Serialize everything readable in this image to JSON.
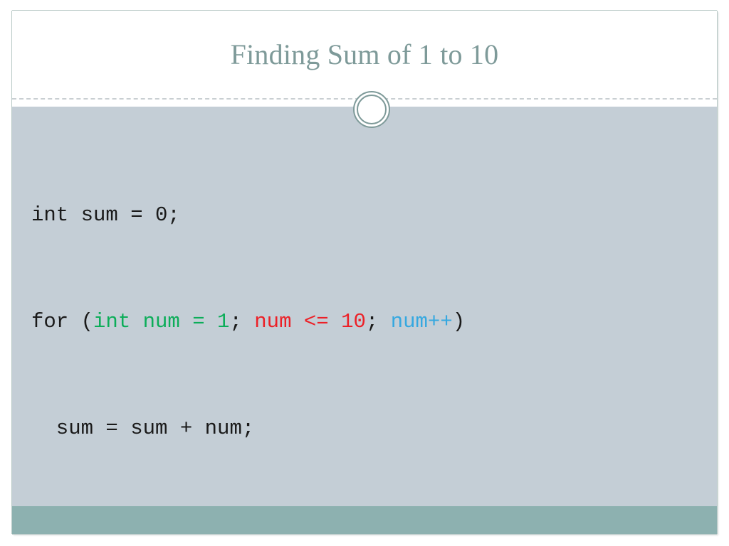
{
  "slide": {
    "title": "Finding Sum of 1 to 10",
    "ornament": "double-ring-ornament",
    "colors": {
      "title": "#7e9a99",
      "header_background": "#ffffff",
      "body_background": "#c4ced6",
      "footer_bar": "#8db1b0",
      "rule": "#c9cfd2",
      "code_plain": "#1a1a1a",
      "code_green": "#0cad59",
      "code_red": "#ec2027",
      "code_blue": "#35a8e0"
    }
  },
  "code": {
    "lines": [
      {
        "id": "line-1",
        "tokens": [
          {
            "text": "int sum = 0;",
            "color": "plain"
          }
        ]
      },
      {
        "id": "line-2",
        "tokens": [
          {
            "text": "for (",
            "color": "plain"
          },
          {
            "text": "int num = 1",
            "color": "green"
          },
          {
            "text": "; ",
            "color": "plain"
          },
          {
            "text": "num <= 10",
            "color": "red"
          },
          {
            "text": "; ",
            "color": "plain"
          },
          {
            "text": "num++",
            "color": "blue"
          },
          {
            "text": ")",
            "color": "plain"
          }
        ]
      },
      {
        "id": "line-3",
        "tokens": [
          {
            "text": "  sum = sum + num;",
            "color": "plain"
          }
        ]
      }
    ]
  }
}
